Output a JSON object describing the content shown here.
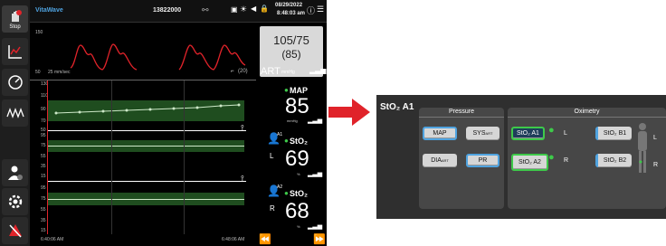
{
  "sidebar": {
    "items": [
      {
        "icon": "stop-icon",
        "label": "Stop"
      },
      {
        "icon": "trend-chart-icon",
        "label": ""
      },
      {
        "icon": "gauge-icon",
        "label": ""
      },
      {
        "icon": "waveform-icon",
        "label": ""
      },
      {
        "icon": "patient-icon",
        "label": ""
      },
      {
        "icon": "settings-icon",
        "label": ""
      },
      {
        "icon": "alarm-silence-icon",
        "label": ""
      }
    ]
  },
  "topbar": {
    "brand": "VitaWave",
    "patient_id": "13822000",
    "date": "08/29/2022",
    "time": "8:48:03 am"
  },
  "art_panel": {
    "scale_top": "150",
    "scale_bottom": "50",
    "speed": "25 mm/sec",
    "pressure": "105/75",
    "map": "(85)",
    "label": "ART",
    "unit": "mmHg",
    "scale_badge": "(20)"
  },
  "map_panel": {
    "ticks": [
      "130",
      "110",
      "90",
      "70",
      "50"
    ],
    "label": "MAP",
    "value": "85",
    "unit": "mmHg"
  },
  "sto2_left": {
    "ticks": [
      "95",
      "75",
      "55",
      "35",
      "15"
    ],
    "channel": "A1",
    "label": "StO₂",
    "side": "L",
    "value": "69",
    "unit": "%"
  },
  "sto2_right": {
    "ticks": [
      "95",
      "75",
      "55",
      "35",
      "15"
    ],
    "channel": "A2",
    "label": "StO₂",
    "side": "R",
    "value": "68",
    "unit": "%"
  },
  "time_axis": {
    "start": "6:40:06 AM",
    "end": "6:48:06 AM"
  },
  "config": {
    "title": "StO₂ A1",
    "pressure_group": "Pressure",
    "oximetry_group": "Oximetry",
    "buttons": {
      "map": "MAP",
      "sys": "SYS",
      "sys_sub": "ART",
      "dia": "DIA",
      "dia_sub": "ART",
      "pr": "PR",
      "sto2_a1": "StO₂ A1",
      "sto2_a2": "StO₂ A2",
      "sto2_b1": "StO₂ B1",
      "sto2_b2": "StO₂ B2"
    },
    "side_l": "L",
    "side_r": "R"
  },
  "colors": {
    "accent_green": "#3ec94a",
    "wave_red": "#e0232a",
    "arrow_red": "#e0232a",
    "select_blue": "#4fa3e0"
  }
}
